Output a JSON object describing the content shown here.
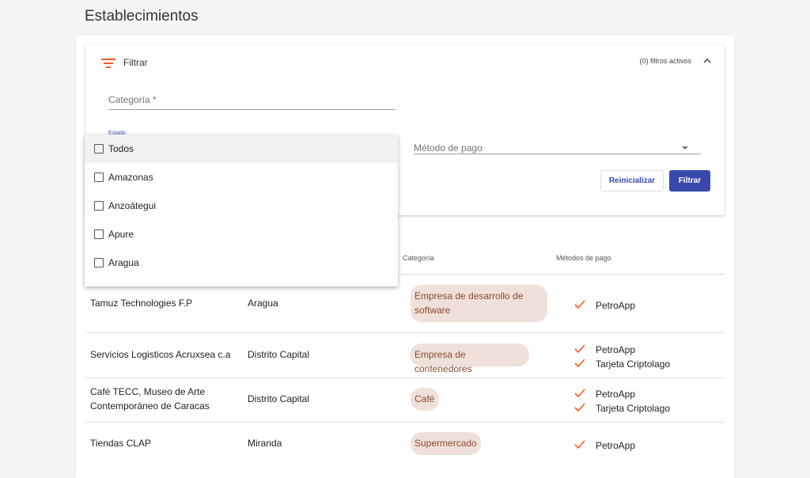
{
  "page": {
    "title": "Establecimientos"
  },
  "filter": {
    "label": "Filtrar",
    "active_filters": "(0) filtros activos",
    "categoria_placeholder": "Categoría *",
    "estado_label": "Estado",
    "metodo_placeholder": "Método de pago",
    "reset_button": "Reinicializar",
    "filter_button": "Filtrar"
  },
  "dropdown": {
    "options": [
      "Todos",
      "Amazonas",
      "Anzoátegui",
      "Apure",
      "Aragua"
    ]
  },
  "table": {
    "headers": {
      "categoria": "Categoría",
      "metodos": "Métodos de pago"
    },
    "rows": [
      {
        "name_lines": [
          "Tamuz Technologies F.P"
        ],
        "estado": "Aragua",
        "categoria_lines": [
          "Empresa de desarrollo de",
          "software"
        ],
        "metodos": [
          "PetroApp"
        ]
      },
      {
        "name_lines": [
          "Servicios Logisticos Acruxsea c.a"
        ],
        "estado": "Distrito Capital",
        "categoria_lines": [
          "Empresa de contenedores"
        ],
        "metodos": [
          "PetroApp",
          "Tarjeta Criptolago"
        ]
      },
      {
        "name_lines": [
          "Café TECC, Museo de Arte",
          "Contemporáneo de Caracas"
        ],
        "estado": "Distrito Capital",
        "categoria_lines": [
          "Café"
        ],
        "metodos": [
          "PetroApp",
          "Tarjeta Criptolago"
        ]
      },
      {
        "name_lines": [
          "Tiendas CLAP"
        ],
        "estado": "Miranda",
        "categoria_lines": [
          "Supermercado"
        ],
        "metodos": [
          "PetroApp"
        ]
      }
    ]
  },
  "colors": {
    "accent": "#ff5722",
    "primary": "#3949ab",
    "chip_bg": "#efe0d9",
    "chip_text": "#8d4a30"
  }
}
